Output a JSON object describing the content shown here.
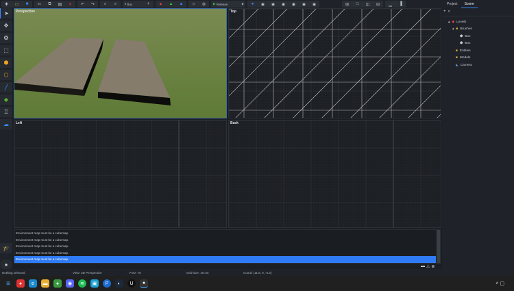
{
  "toolbar": {
    "mode_combo": "Box",
    "release_combo": "Release",
    "build_icons": [
      "new-icon",
      "open-icon",
      "save-icon",
      "cut-icon",
      "copy-icon",
      "paste-icon",
      "delete-icon",
      "undo-icon",
      "redo-icon",
      "zoom-in-icon",
      "zoom-out-icon"
    ]
  },
  "viewports": {
    "perspective": "Perspective",
    "top": "Top",
    "left": "Left",
    "back": "Back"
  },
  "panel": {
    "tabs": [
      "Project",
      "Scene"
    ],
    "active_tab": "Scene",
    "tree": [
      {
        "label": "Level0",
        "depth": 0
      },
      {
        "label": "Brushes",
        "depth": 1
      },
      {
        "label": "Box",
        "depth": 2
      },
      {
        "label": "Box",
        "depth": 2
      },
      {
        "label": "Entities",
        "depth": 1
      },
      {
        "label": "Models",
        "depth": 1
      },
      {
        "label": "Camera",
        "depth": 1
      }
    ]
  },
  "console": {
    "messages": [
      "Environment map must be a cubemap.",
      "Environment map must be a cubemap.",
      "Environment map must be a cubemap.",
      "Environment map must be a cubemap.",
      "Environment map must be a cubemap."
    ],
    "selected_index": 4
  },
  "status": {
    "selection": "Nothing selected",
    "view": "View: 3D Perspective",
    "fov": "FOV: 70",
    "grid": "Grid size: 16 cm",
    "coord": "Coord: (11.6, 0, -5.2)"
  },
  "colors": {
    "accent": "#2f7bf5",
    "bg": "#1b1e23"
  }
}
